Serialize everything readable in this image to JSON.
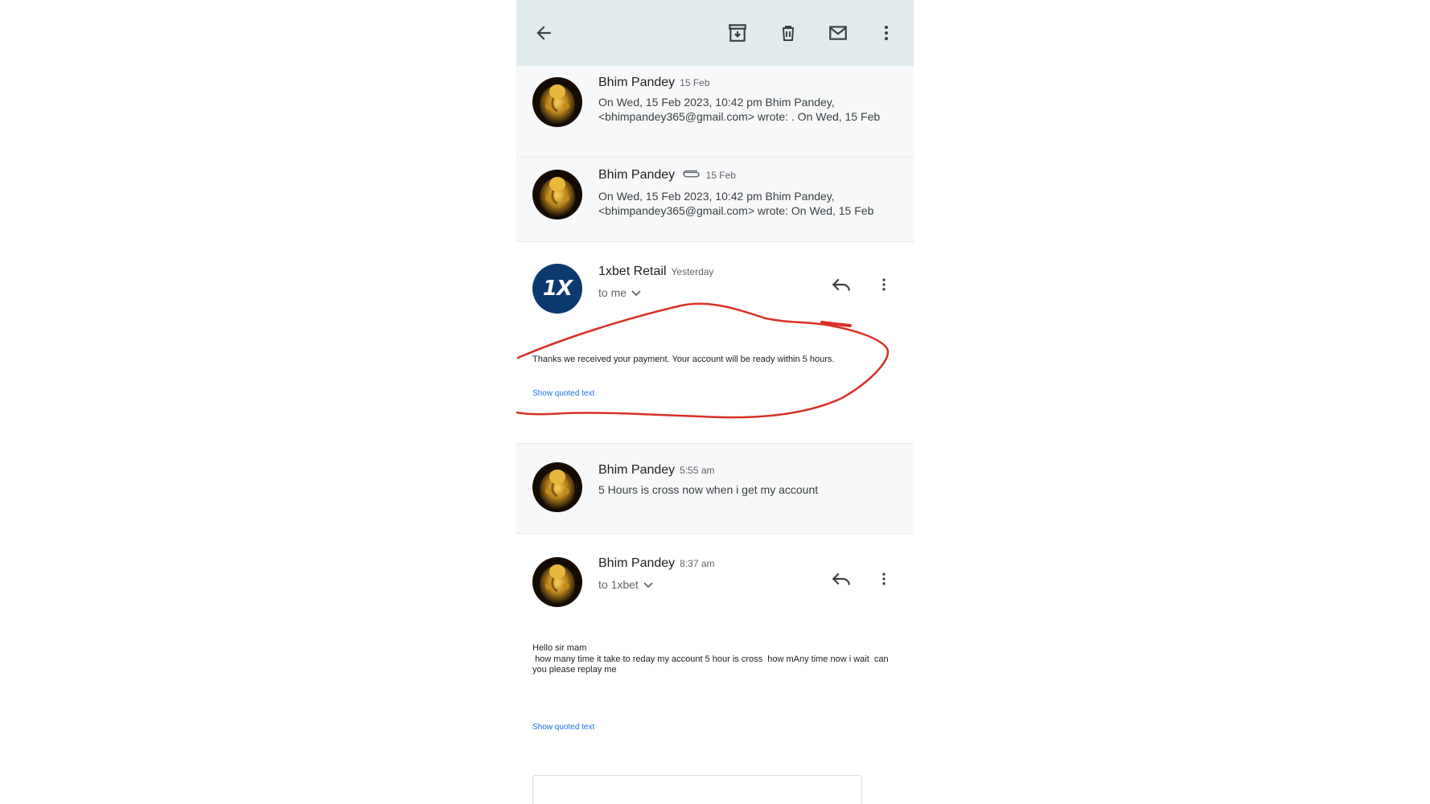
{
  "toolbar": {
    "back_icon": "arrow-left-icon",
    "archive_icon": "archive-icon",
    "delete_icon": "trash-icon",
    "mark_unread_icon": "mail-icon",
    "more_icon": "more-vert-icon"
  },
  "messages": [
    {
      "sender": "Bhim Pandey",
      "date": "15 Feb",
      "snippet": "On Wed, 15 Feb 2023, 10:42 pm Bhim Pandey, <bhimpandey365@gmail.com> wrote: . On Wed, 15 Feb"
    },
    {
      "sender": "Bhim Pandey",
      "date": "15 Feb",
      "attachment_icon": "paperclip-icon",
      "snippet": "On Wed, 15 Feb 2023, 10:42 pm Bhim Pandey, <bhimpandey365@gmail.com> wrote: On Wed, 15 Feb"
    },
    {
      "sender": "1xbet Retail",
      "date": "Yesterday",
      "recipient": "to me",
      "avatar_text": "1X",
      "body": "Thanks we received your payment. Your account will be ready within 5 hours.",
      "show_quoted": "Show quoted text"
    },
    {
      "sender": "Bhim Pandey",
      "date": "5:55 am",
      "snippet": "5 Hours is cross now when i get my account"
    },
    {
      "sender": "Bhim Pandey",
      "date": "8:37 am",
      "recipient": "to 1xbet",
      "body": "Hello sir mam\n how many time it take to reday my account 5 hour is cross  how mAny time now i wait  can you please replay me",
      "show_quoted": "Show quoted text"
    }
  ],
  "colors": {
    "toolbar_bg": "#e1ebee",
    "collapsed_bg": "#f7f8f9",
    "link": "#1a73e8",
    "annotation": "#d93025",
    "xbet_blue": "#0d3a6e"
  }
}
